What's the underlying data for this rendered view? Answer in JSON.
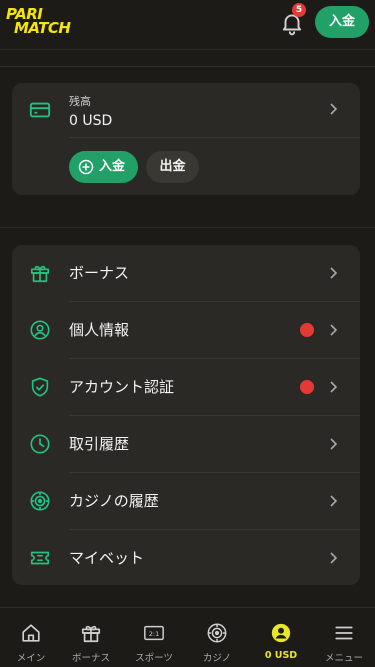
{
  "header": {
    "logo_line1": "PARI",
    "logo_line2": "MATCH",
    "notification_count": "5",
    "deposit_label": "入金"
  },
  "balance": {
    "label": "残高",
    "value": "0 USD",
    "deposit_label": "入金",
    "withdraw_label": "出金"
  },
  "menu": {
    "items": [
      {
        "label": "ボーナス",
        "icon": "gift-icon",
        "alert": false
      },
      {
        "label": "個人情報",
        "icon": "user-circle-icon",
        "alert": true
      },
      {
        "label": "アカウント認証",
        "icon": "shield-check-icon",
        "alert": true
      },
      {
        "label": "取引履歴",
        "icon": "clock-icon",
        "alert": false
      },
      {
        "label": "カジノの履歴",
        "icon": "casino-chip-icon",
        "alert": false
      },
      {
        "label": "マイベット",
        "icon": "ticket-icon",
        "alert": false
      }
    ]
  },
  "tabbar": {
    "items": [
      {
        "label": "メイン",
        "icon": "home-icon"
      },
      {
        "label": "ボーナス",
        "icon": "gift-icon"
      },
      {
        "label": "スポーツ",
        "icon": "scoreboard-icon"
      },
      {
        "label": "カジノ",
        "icon": "roulette-icon"
      },
      {
        "label": "0 USD",
        "icon": "account-icon",
        "active": true
      },
      {
        "label": "メニュー",
        "icon": "hamburger-icon"
      }
    ]
  },
  "colors": {
    "accent_green": "#21a067",
    "alert_red": "#e53935",
    "brand_yellow": "#f5e50a",
    "active_tab": "#e9e62a"
  }
}
